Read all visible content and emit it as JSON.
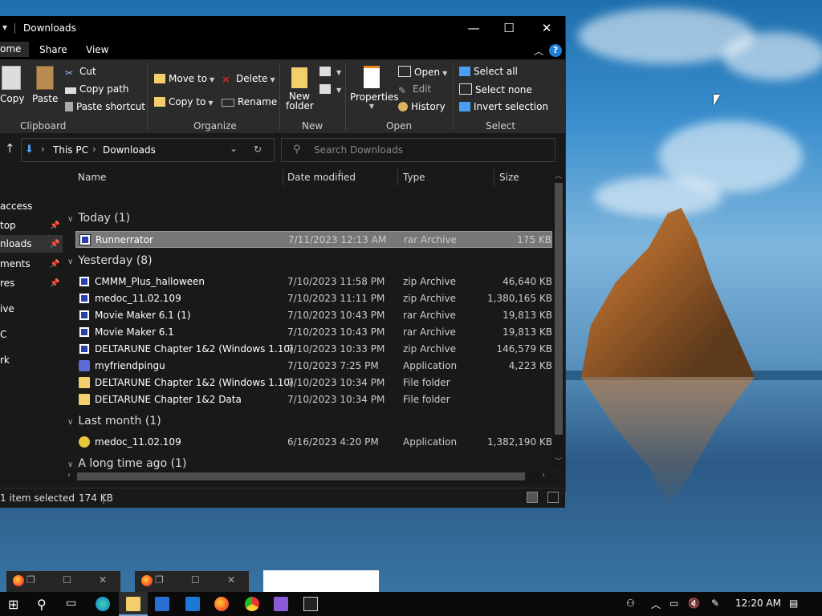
{
  "window": {
    "title": "Downloads",
    "minimize": "—",
    "maximize": "☐",
    "close": "✕"
  },
  "ribbon_tabs": [
    "ome",
    "Share",
    "View"
  ],
  "ribbon": {
    "clipboard": {
      "copy": "Copy",
      "paste": "Paste",
      "cut": "Cut",
      "copy_path": "Copy path",
      "paste_shortcut": "Paste shortcut",
      "label": "Clipboard"
    },
    "organize": {
      "move_to": "Move to",
      "copy_to": "Copy to",
      "delete": "Delete",
      "rename": "Rename",
      "label": "Organize"
    },
    "new": {
      "new_folder_line1": "New",
      "new_folder_line2": "folder",
      "label": "New"
    },
    "open": {
      "properties": "Properties",
      "open": "Open",
      "edit": "Edit",
      "history": "History",
      "label": "Open"
    },
    "select": {
      "select_all": "Select all",
      "select_none": "Select none",
      "invert": "Invert selection",
      "label": "Select"
    }
  },
  "address": {
    "crumbs": [
      "This PC",
      "Downloads"
    ],
    "search_placeholder": "Search Downloads"
  },
  "nav": [
    {
      "label": "access",
      "pinned": false
    },
    {
      "label": "top",
      "pinned": true
    },
    {
      "label": "nloads",
      "pinned": true
    },
    {
      "label": "ments",
      "pinned": true
    },
    {
      "label": "res",
      "pinned": true
    },
    {
      "label": "ive",
      "pinned": false
    },
    {
      "label": "C",
      "pinned": false
    },
    {
      "label": "rk",
      "pinned": false
    }
  ],
  "columns": {
    "name": "Name",
    "date": "Date modified",
    "type": "Type",
    "size": "Size"
  },
  "groups": [
    {
      "label": "Today (1)",
      "files": [
        {
          "name": "Runnerrator",
          "date": "7/11/2023 12:13 AM",
          "type": "rar Archive",
          "size": "175 KB",
          "icon": "archive-icon",
          "selected": true
        }
      ]
    },
    {
      "label": "Yesterday (8)",
      "files": [
        {
          "name": "CMMM_Plus_halloween",
          "date": "7/10/2023 11:58 PM",
          "type": "zip Archive",
          "size": "46,640 KB",
          "icon": "archive-icon"
        },
        {
          "name": "medoc_11.02.109",
          "date": "7/10/2023 11:11 PM",
          "type": "zip Archive",
          "size": "1,380,165 KB",
          "icon": "archive-icon"
        },
        {
          "name": "Movie Maker 6.1 (1)",
          "date": "7/10/2023 10:43 PM",
          "type": "rar Archive",
          "size": "19,813 KB",
          "icon": "archive-icon"
        },
        {
          "name": "Movie Maker 6.1",
          "date": "7/10/2023 10:43 PM",
          "type": "rar Archive",
          "size": "19,813 KB",
          "icon": "archive-icon"
        },
        {
          "name": "DELTARUNE Chapter 1&2 (Windows 1.10)",
          "date": "7/10/2023 10:33 PM",
          "type": "zip Archive",
          "size": "146,579 KB",
          "icon": "archive-icon"
        },
        {
          "name": "myfriendpingu",
          "date": "7/10/2023 7:25 PM",
          "type": "Application",
          "size": "4,223 KB",
          "icon": "app-icon"
        },
        {
          "name": "DELTARUNE Chapter 1&2 (Windows 1.10)",
          "date": "7/10/2023 10:34 PM",
          "type": "File folder",
          "size": "",
          "icon": "folder-icon"
        },
        {
          "name": "DELTARUNE Chapter 1&2 Data",
          "date": "7/10/2023 10:34 PM",
          "type": "File folder",
          "size": "",
          "icon": "folder-icon"
        }
      ]
    },
    {
      "label": "Last month (1)",
      "files": [
        {
          "name": "medoc_11.02.109",
          "date": "6/16/2023 4:20 PM",
          "type": "Application",
          "size": "1,382,190 KB",
          "icon": "setup-icon"
        }
      ]
    },
    {
      "label": "A long time ago (1)",
      "files": []
    }
  ],
  "status": {
    "count": "1 item selected",
    "size": "174 KB"
  },
  "clock": "12:20 AM"
}
